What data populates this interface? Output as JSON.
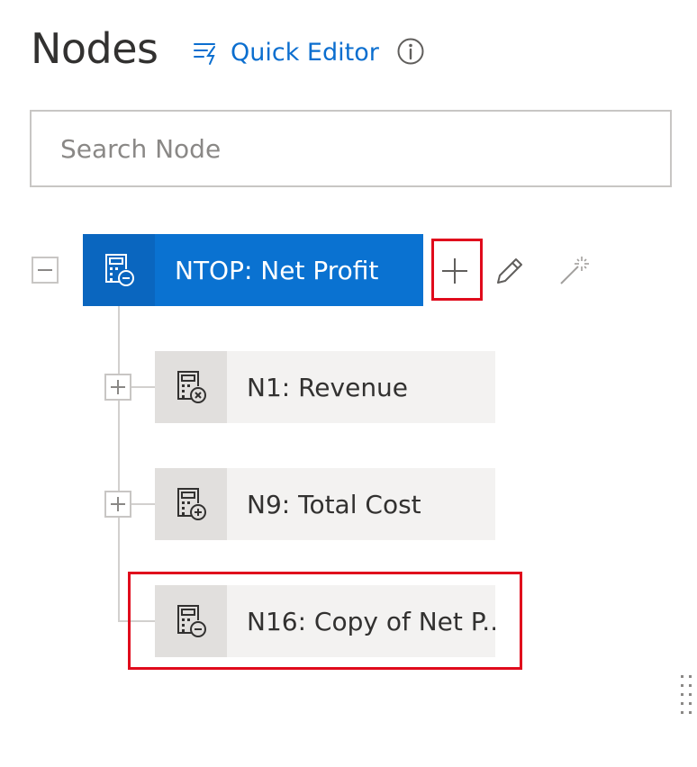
{
  "header": {
    "title": "Nodes",
    "quick_editor_label": "Quick Editor"
  },
  "search": {
    "placeholder": "Search Node",
    "value": ""
  },
  "tree": {
    "root": {
      "label": "NTOP: Net Profit",
      "icon": "calculator-minus-icon",
      "expanded": true,
      "selected": true
    },
    "children": [
      {
        "label": "N1: Revenue",
        "icon": "calculator-multiply-icon",
        "expandable": true
      },
      {
        "label": "N9: Total Cost",
        "icon": "calculator-plus-icon",
        "expandable": true
      },
      {
        "label": "N16: Copy of Net P...",
        "icon": "calculator-minus-icon",
        "expandable": false
      }
    ]
  },
  "actions": {
    "add": "add-icon",
    "edit": "pencil-icon",
    "wand": "magic-wand-icon"
  },
  "colors": {
    "accent": "#0a72d1",
    "link": "#0b6ecf",
    "highlight": "#e00b1c",
    "node_bg": "#f3f2f1"
  }
}
